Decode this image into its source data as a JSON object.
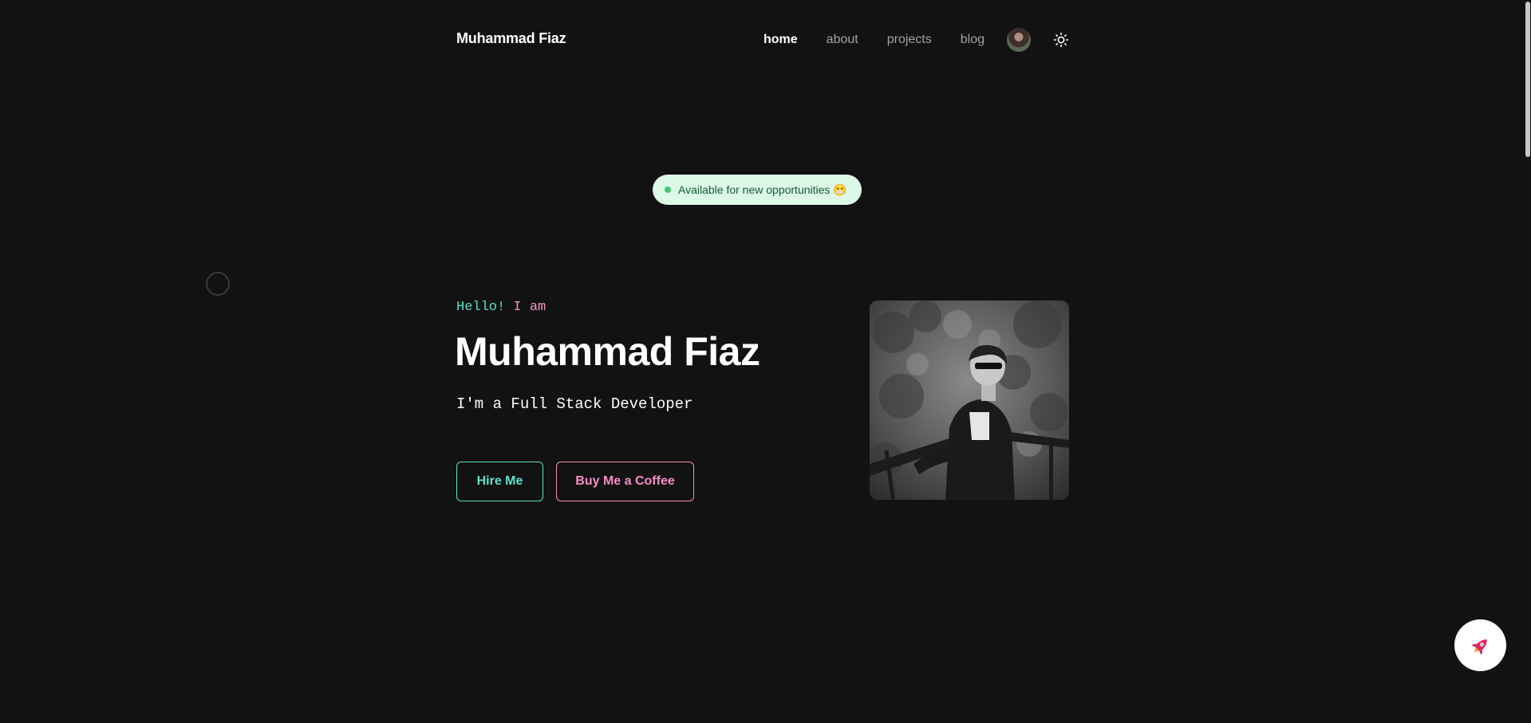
{
  "header": {
    "brand": "Muhammad Fiaz",
    "nav": [
      {
        "label": "home",
        "active": true
      },
      {
        "label": "about",
        "active": false
      },
      {
        "label": "projects",
        "active": false
      },
      {
        "label": "blog",
        "active": false
      }
    ],
    "avatar_icon": "user-avatar",
    "theme_icon": "sun-icon"
  },
  "badge": {
    "text": "Available for new opportunities 😁",
    "dot_color": "#46c779",
    "background": "#dcf8e6"
  },
  "hero": {
    "greeting_part1": "Hello!",
    "greeting_part2": " I am",
    "name": "Muhammad Fiaz",
    "role": "I'm a Full Stack Developer",
    "buttons": {
      "hire": "Hire Me",
      "coffee": "Buy Me a Coffee"
    },
    "portrait_icon": "profile-photo"
  },
  "fab": {
    "icon": "rocket-icon"
  },
  "colors": {
    "background": "#121212",
    "accent_teal": "#5ee0c6",
    "accent_pink": "#f48fc4"
  }
}
